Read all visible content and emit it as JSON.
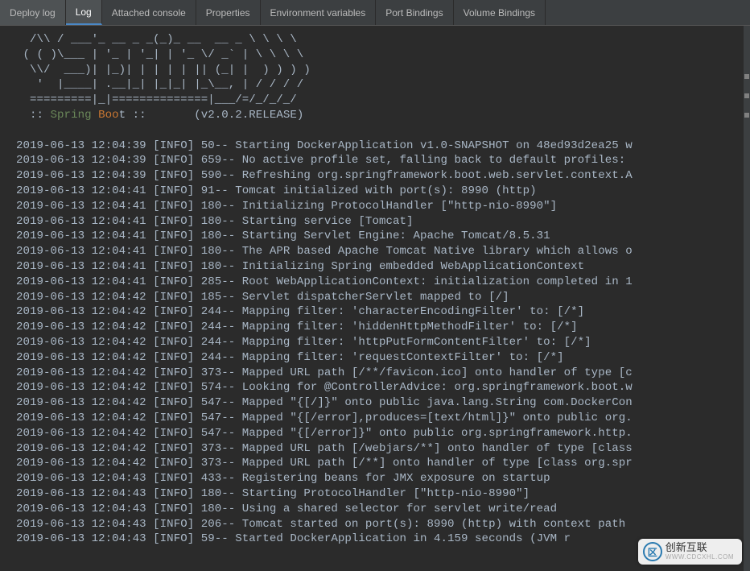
{
  "tabs": [
    {
      "label": "Deploy log",
      "active": false
    },
    {
      "label": "Log",
      "active": true
    },
    {
      "label": "Attached console",
      "active": false
    },
    {
      "label": "Properties",
      "active": false
    },
    {
      "label": "Environment variables",
      "active": false
    },
    {
      "label": "Port Bindings",
      "active": false
    },
    {
      "label": "Volume Bindings",
      "active": false
    }
  ],
  "banner": [
    "  /\\\\ / ___'_ __ _ _(_)_ __  __ _ \\ \\ \\ \\",
    " ( ( )\\___ | '_ | '_| | '_ \\/ _` | \\ \\ \\ \\",
    "  \\\\/  ___)| |_)| | | | | || (_| |  ) ) ) )",
    "   '  |____| .__|_| |_|_| |_\\__, | / / / /",
    "  =========|_|==============|___/=/_/_/_/"
  ],
  "spring_line": {
    "prefix": "  :: ",
    "spring": "Spring",
    "space": " ",
    "boo": "Boo",
    "t": "t",
    "mid": " ::       ",
    "ver": "(v2.0.2.RELEASE)"
  },
  "log_lines": [
    {
      "ts": "2019-06-13 12:04:39",
      "lvl": "[INFO]",
      "code": "50--",
      "msg": "Starting DockerApplication v1.0-SNAPSHOT on 48ed93d2ea25 w"
    },
    {
      "ts": "2019-06-13 12:04:39",
      "lvl": "[INFO]",
      "code": "659--",
      "msg": "No active profile set, falling back to default profiles:"
    },
    {
      "ts": "2019-06-13 12:04:39",
      "lvl": "[INFO]",
      "code": "590--",
      "msg": "Refreshing org.springframework.boot.web.servlet.context.A"
    },
    {
      "ts": "2019-06-13 12:04:41",
      "lvl": "[INFO]",
      "code": "91--",
      "msg": "Tomcat initialized with port(s): 8990 (http)"
    },
    {
      "ts": "2019-06-13 12:04:41",
      "lvl": "[INFO]",
      "code": "180--",
      "msg": "Initializing ProtocolHandler [\"http-nio-8990\"]"
    },
    {
      "ts": "2019-06-13 12:04:41",
      "lvl": "[INFO]",
      "code": "180--",
      "msg": "Starting service [Tomcat]"
    },
    {
      "ts": "2019-06-13 12:04:41",
      "lvl": "[INFO]",
      "code": "180--",
      "msg": "Starting Servlet Engine: Apache Tomcat/8.5.31"
    },
    {
      "ts": "2019-06-13 12:04:41",
      "lvl": "[INFO]",
      "code": "180--",
      "msg": "The APR based Apache Tomcat Native library which allows o"
    },
    {
      "ts": "2019-06-13 12:04:41",
      "lvl": "[INFO]",
      "code": "180--",
      "msg": "Initializing Spring embedded WebApplicationContext"
    },
    {
      "ts": "2019-06-13 12:04:41",
      "lvl": "[INFO]",
      "code": "285--",
      "msg": "Root WebApplicationContext: initialization completed in 1"
    },
    {
      "ts": "2019-06-13 12:04:42",
      "lvl": "[INFO]",
      "code": "185--",
      "msg": "Servlet dispatcherServlet mapped to [/]"
    },
    {
      "ts": "2019-06-13 12:04:42",
      "lvl": "[INFO]",
      "code": "244--",
      "msg": "Mapping filter: 'characterEncodingFilter' to: [/*]"
    },
    {
      "ts": "2019-06-13 12:04:42",
      "lvl": "[INFO]",
      "code": "244--",
      "msg": "Mapping filter: 'hiddenHttpMethodFilter' to: [/*]"
    },
    {
      "ts": "2019-06-13 12:04:42",
      "lvl": "[INFO]",
      "code": "244--",
      "msg": "Mapping filter: 'httpPutFormContentFilter' to: [/*]"
    },
    {
      "ts": "2019-06-13 12:04:42",
      "lvl": "[INFO]",
      "code": "244--",
      "msg": "Mapping filter: 'requestContextFilter' to: [/*]"
    },
    {
      "ts": "2019-06-13 12:04:42",
      "lvl": "[INFO]",
      "code": "373--",
      "msg": "Mapped URL path [/**/favicon.ico] onto handler of type [c"
    },
    {
      "ts": "2019-06-13 12:04:42",
      "lvl": "[INFO]",
      "code": "574--",
      "msg": "Looking for @ControllerAdvice: org.springframework.boot.w"
    },
    {
      "ts": "2019-06-13 12:04:42",
      "lvl": "[INFO]",
      "code": "547--",
      "msg": "Mapped \"{[/]}\" onto public java.lang.String com.DockerCon"
    },
    {
      "ts": "2019-06-13 12:04:42",
      "lvl": "[INFO]",
      "code": "547--",
      "msg": "Mapped \"{[/error],produces=[text/html]}\" onto public org."
    },
    {
      "ts": "2019-06-13 12:04:42",
      "lvl": "[INFO]",
      "code": "547--",
      "msg": "Mapped \"{[/error]}\" onto public org.springframework.http."
    },
    {
      "ts": "2019-06-13 12:04:42",
      "lvl": "[INFO]",
      "code": "373--",
      "msg": "Mapped URL path [/webjars/**] onto handler of type [class"
    },
    {
      "ts": "2019-06-13 12:04:42",
      "lvl": "[INFO]",
      "code": "373--",
      "msg": "Mapped URL path [/**] onto handler of type [class org.spr"
    },
    {
      "ts": "2019-06-13 12:04:43",
      "lvl": "[INFO]",
      "code": "433--",
      "msg": "Registering beans for JMX exposure on startup"
    },
    {
      "ts": "2019-06-13 12:04:43",
      "lvl": "[INFO]",
      "code": "180--",
      "msg": "Starting ProtocolHandler [\"http-nio-8990\"]"
    },
    {
      "ts": "2019-06-13 12:04:43",
      "lvl": "[INFO]",
      "code": "180--",
      "msg": "Using a shared selector for servlet write/read"
    },
    {
      "ts": "2019-06-13 12:04:43",
      "lvl": "[INFO]",
      "code": "206--",
      "msg": "Tomcat started on port(s): 8990 (http) with context path "
    },
    {
      "ts": "2019-06-13 12:04:43",
      "lvl": "[INFO]",
      "code": "59--",
      "msg": "Started DockerApplication in 4.159 seconds (JVM r"
    }
  ],
  "watermark": {
    "logo": "区",
    "main": "创新互联",
    "sub": "WWW.CDCXHL.COM"
  }
}
